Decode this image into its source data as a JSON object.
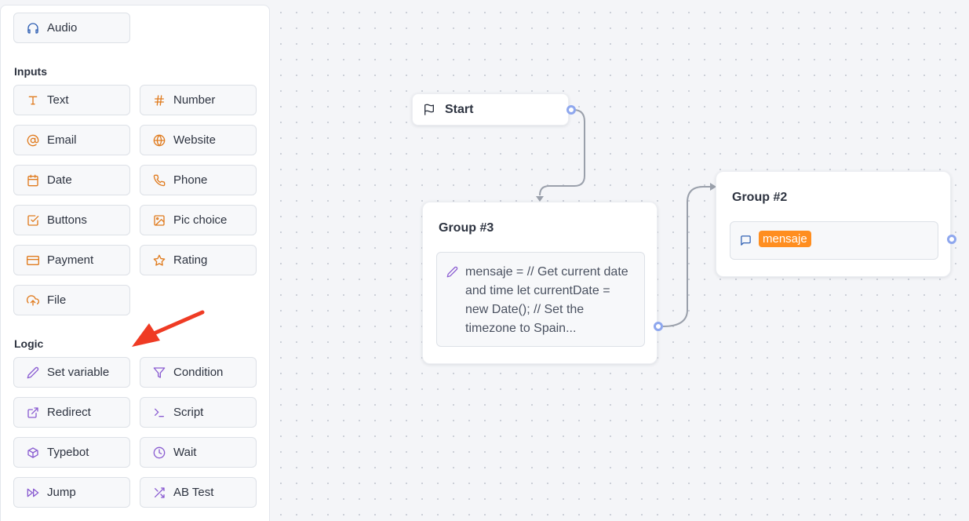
{
  "sidebar": {
    "top_items": [
      {
        "label": "Audio",
        "icon": "headphones-icon"
      }
    ],
    "sections": [
      {
        "title": "Inputs",
        "items": [
          {
            "label": "Text",
            "icon": "text-icon"
          },
          {
            "label": "Number",
            "icon": "hash-icon"
          },
          {
            "label": "Email",
            "icon": "at-sign-icon"
          },
          {
            "label": "Website",
            "icon": "globe-icon"
          },
          {
            "label": "Date",
            "icon": "calendar-icon"
          },
          {
            "label": "Phone",
            "icon": "phone-icon"
          },
          {
            "label": "Buttons",
            "icon": "checkbox-icon"
          },
          {
            "label": "Pic choice",
            "icon": "image-icon"
          },
          {
            "label": "Payment",
            "icon": "credit-card-icon"
          },
          {
            "label": "Rating",
            "icon": "star-icon"
          },
          {
            "label": "File",
            "icon": "upload-icon"
          }
        ]
      },
      {
        "title": "Logic",
        "items": [
          {
            "label": "Set variable",
            "icon": "pencil-icon"
          },
          {
            "label": "Condition",
            "icon": "filter-icon"
          },
          {
            "label": "Redirect",
            "icon": "external-link-icon"
          },
          {
            "label": "Script",
            "icon": "terminal-icon"
          },
          {
            "label": "Typebot",
            "icon": "cube-icon"
          },
          {
            "label": "Wait",
            "icon": "clock-icon"
          },
          {
            "label": "Jump",
            "icon": "fast-forward-icon"
          },
          {
            "label": "AB Test",
            "icon": "shuffle-icon"
          }
        ]
      }
    ]
  },
  "canvas": {
    "start_node": {
      "label": "Start",
      "icon": "flag-icon"
    },
    "group3": {
      "title": "Group #3",
      "block_text": "mensaje = // Get current date and time let currentDate = new Date(); // Set the timezone to Spain...",
      "icon": "pencil-icon"
    },
    "group2": {
      "title": "Group #2",
      "variable": "mensaje",
      "icon": "chat-bubble-icon"
    }
  },
  "colors": {
    "input_accent": "#e07b1e",
    "logic_accent": "#8a5cd1",
    "audio_accent": "#2f5fb3",
    "port_ring": "#8ea7ee",
    "variable_tag": "#ff8e20",
    "annotation_arrow": "#ef3b24"
  }
}
